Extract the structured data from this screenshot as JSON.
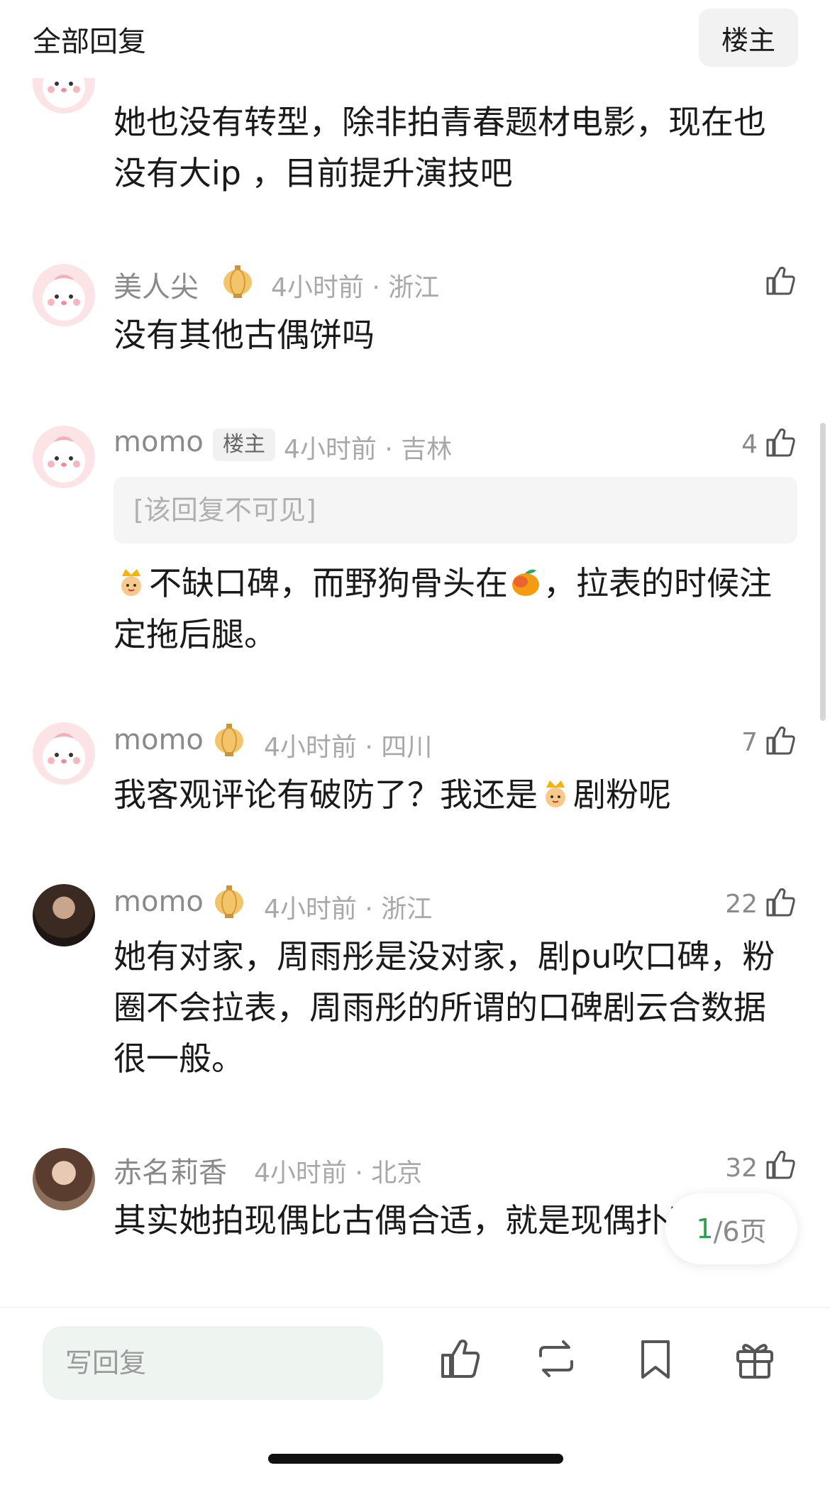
{
  "header": {
    "title": "全部回复",
    "author_button": "楼主"
  },
  "comments": [
    {
      "name": "",
      "text": "她也没有转型，除非拍青春题材电影，现在也没有大ip ，目前提升演技吧"
    },
    {
      "name": "美人尖",
      "meta": "4小时前 · 浙江",
      "likes": "",
      "text": "没有其他古偶饼吗"
    },
    {
      "name": "momo",
      "op_tag": "楼主",
      "meta": "4小时前 · 吉林",
      "likes": "4",
      "hidden_reply": "[该回复不可见]",
      "text_a": "不缺口碑，而野狗骨头在",
      "text_b": "，拉表的时候注定拖后腿。"
    },
    {
      "name": "momo",
      "meta": "4小时前 · 四川",
      "likes": "7",
      "text_a": "我客观评论有破防了？我还是",
      "text_b": "剧粉呢"
    },
    {
      "name": "momo",
      "meta": "4小时前 · 浙江",
      "likes": "22",
      "text": "她有对家，周雨彤是没对家，剧pu吹口碑，粉圈不会拉表，周雨彤的所谓的口碑剧云合数据很一般。"
    },
    {
      "name": "赤名莉香",
      "meta": "4小时前 · 北京",
      "likes": "32",
      "text": "其实她拍现偶比古偶合适，就是现偶扑了"
    }
  ],
  "pagination": {
    "current": "1",
    "total": "/6页"
  },
  "bottom_bar": {
    "reply_placeholder": "写回复"
  },
  "colors": {
    "accent_green": "#2e9e4f",
    "meta_gray": "#a8a8a8",
    "text": "#1a1a1a"
  }
}
